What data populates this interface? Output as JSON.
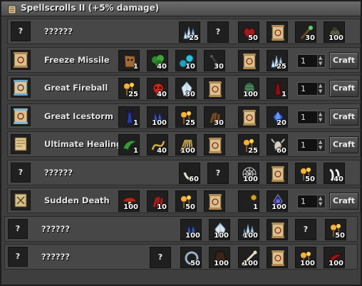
{
  "window": {
    "title": "Spellscrolls II (+5% damage)"
  },
  "unknown": "?",
  "colors": {
    "panel": "#3e3e3e",
    "row": "#474747",
    "slot": "#1f1f1f",
    "text": "#e4e4e4"
  },
  "rows": [
    {
      "name": "??????",
      "quantity": null,
      "craft": null,
      "ingredients": [
        {
          "icon": "ice-crystal-icon",
          "qty": "25"
        },
        {
          "icon": "unknown",
          "qty": ""
        },
        {
          "icon": "red-heart-icon",
          "qty": "50"
        },
        {
          "icon": "scroll-icon",
          "qty": ""
        },
        {
          "icon": "magic-wand-icon",
          "qty": "30"
        },
        {
          "icon": "beetle-icon",
          "qty": "100"
        }
      ]
    },
    {
      "name": "Freeze Missile",
      "quantity": "1",
      "craft": "Craft",
      "ingredients": [
        {
          "icon": "skin-icon",
          "qty": "1"
        },
        {
          "icon": "green-herb-icon",
          "qty": "40"
        },
        {
          "icon": "blue-orbs-icon",
          "qty": "10"
        },
        {
          "icon": "pestle-icon",
          "qty": "30"
        },
        {
          "icon": "scroll-icon",
          "qty": ""
        },
        {
          "icon": "ice-crystal-icon",
          "qty": "25"
        }
      ]
    },
    {
      "name": "Great Fireball",
      "quantity": "1",
      "craft": "Craft",
      "ingredients": [
        {
          "icon": "flame-torch-icon",
          "qty": "25"
        },
        {
          "icon": "red-skull-icon",
          "qty": "40"
        },
        {
          "icon": "white-crystal-icon",
          "qty": "30"
        },
        {
          "icon": "scroll-icon",
          "qty": ""
        },
        {
          "icon": "green-scale-icon",
          "qty": "100"
        },
        {
          "icon": "demon-icon",
          "qty": "1"
        }
      ]
    },
    {
      "name": "Great Icestorm",
      "quantity": "1",
      "craft": "Craft",
      "ingredients": [
        {
          "icon": "blue-demon-icon",
          "qty": "1"
        },
        {
          "icon": "blue-cloth-icon",
          "qty": "100"
        },
        {
          "icon": "flame-torch-icon",
          "qty": "25"
        },
        {
          "icon": "brown-claw-icon",
          "qty": "30"
        },
        {
          "icon": "scroll-icon",
          "qty": ""
        },
        {
          "icon": "blue-gem-icon",
          "qty": "20"
        }
      ]
    },
    {
      "name": "Ultimate Healing",
      "quantity": "1",
      "craft": "Craft",
      "ingredients": [
        {
          "icon": "green-claw-icon",
          "qty": "1"
        },
        {
          "icon": "yellow-rope-icon",
          "qty": "40"
        },
        {
          "icon": "straw-icon",
          "qty": "100"
        },
        {
          "icon": "scroll-icon",
          "qty": ""
        },
        {
          "icon": "flame-torch-icon",
          "qty": "25"
        },
        {
          "icon": "goat-skull-icon",
          "qty": "60"
        }
      ]
    },
    {
      "name": "??????",
      "quantity": null,
      "craft": null,
      "ingredients": [
        {
          "icon": "white-tusk-icon",
          "qty": "60"
        },
        {
          "icon": "unknown",
          "qty": ""
        },
        {
          "icon": "spider-web-icon",
          "qty": "100"
        },
        {
          "icon": "scroll-icon",
          "qty": ""
        },
        {
          "icon": "flame-torch-icon",
          "qty": "50"
        },
        {
          "icon": "white-fang-icon",
          "qty": "40"
        }
      ]
    },
    {
      "name": "Sudden Death",
      "quantity": "1",
      "craft": "Craft",
      "ingredients": [
        {
          "icon": "red-mushroom-icon",
          "qty": "100"
        },
        {
          "icon": "red-claw-icon",
          "qty": "10"
        },
        {
          "icon": "flame-torch-icon",
          "qty": "50"
        },
        {
          "icon": "scroll-icon",
          "qty": ""
        },
        {
          "icon": "black-staff-icon",
          "qty": "1"
        },
        {
          "icon": "dark-crystal-icon",
          "qty": "100"
        }
      ]
    },
    {
      "name": "??????",
      "quantity": null,
      "craft": null,
      "ingredients": [
        {
          "icon": "blue-cloth-icon",
          "qty": "100"
        },
        {
          "icon": "white-crystal-icon",
          "qty": "100"
        },
        {
          "icon": "ice-crystal-icon",
          "qty": "100"
        },
        {
          "icon": "scroll-icon",
          "qty": ""
        },
        {
          "icon": "unknown",
          "qty": ""
        },
        {
          "icon": "flame-torch-icon",
          "qty": "50"
        }
      ]
    },
    {
      "name": "??????",
      "quantity": null,
      "craft": null,
      "ingredients": [
        {
          "icon": "unknown",
          "qty": ""
        },
        {
          "icon": "steel-ring-icon",
          "qty": "50"
        },
        {
          "icon": "dark-cloak-icon",
          "qty": "100"
        },
        {
          "icon": "bone-icon",
          "qty": "100"
        },
        {
          "icon": "scroll-icon",
          "qty": ""
        },
        {
          "icon": "flame-torch-icon",
          "qty": "100"
        },
        {
          "icon": "red-horn-icon",
          "qty": "100"
        }
      ]
    }
  ]
}
